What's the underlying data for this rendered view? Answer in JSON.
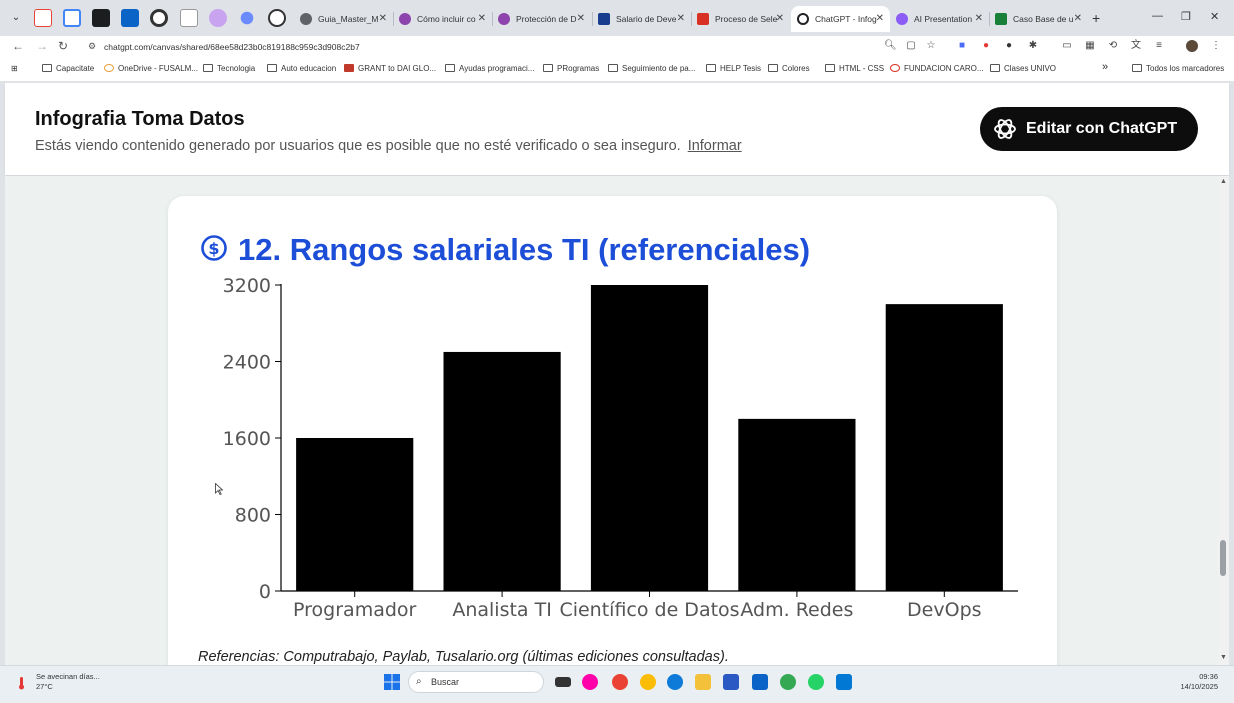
{
  "browser": {
    "tabs": [
      {
        "label": "Guia_Master_M",
        "color": "#5f6368"
      },
      {
        "label": "Cómo incluir co",
        "color": "#8e44ad"
      },
      {
        "label": "Protección de D",
        "color": "#8e44ad"
      },
      {
        "label": "Salario de Deve",
        "color": "#1a3c8f"
      },
      {
        "label": "Proceso de Sele",
        "color": "#d93025"
      },
      {
        "label": "ChatGPT - Infog",
        "color": "#202124",
        "active": true
      },
      {
        "label": "AI Presentation",
        "color": "#8b5cf6"
      },
      {
        "label": "Caso Base de u",
        "color": "#188038"
      }
    ],
    "url": "chatgpt.com/canvas/shared/68ee58d23b0c819188c959c3d908c2b7",
    "bookmarks": [
      "Capacitate",
      "OneDrive - FUSALM...",
      "Tecnologia",
      "Auto educacion",
      "GRANT to DAI GLO...",
      "Ayudas programaci...",
      "PRogramas",
      "Seguimiento de pa...",
      "HELP Tesis",
      "Colores",
      "HTML - CSS",
      "FUNDACION CARO...",
      "Clases UNIVO"
    ],
    "bookmarks_more": "»",
    "all_bookmarks": "Todos los marcadores"
  },
  "page": {
    "title": "Infografia Toma Datos",
    "notice": "Estás viendo contenido generado por usuarios que es posible que no esté verificado o sea inseguro.",
    "report_link": "Informar",
    "edit_button": "Editar con ChatGPT"
  },
  "section": {
    "title": "12. Rangos salariales TI (referenciales)",
    "references": "Referencias: Computrabajo, Paylab, Tusalario.org (últimas ediciones consultadas)."
  },
  "chart_data": {
    "type": "bar",
    "title": "",
    "categories": [
      "Programador",
      "Analista TI",
      "Científico de Datos",
      "Adm. Redes",
      "DevOps"
    ],
    "values": [
      1600,
      2500,
      3200,
      1800,
      3000
    ],
    "ylim": [
      0,
      3200
    ],
    "yticks": [
      0,
      800,
      1600,
      2400,
      3200
    ],
    "bar_color": "#000000",
    "grid": false,
    "legend": false
  },
  "taskbar": {
    "weather_title": "Se avecinan días...",
    "weather_temp": "27°C",
    "search_label": "Buscar",
    "time": "09:36",
    "date": "14/10/2025"
  }
}
